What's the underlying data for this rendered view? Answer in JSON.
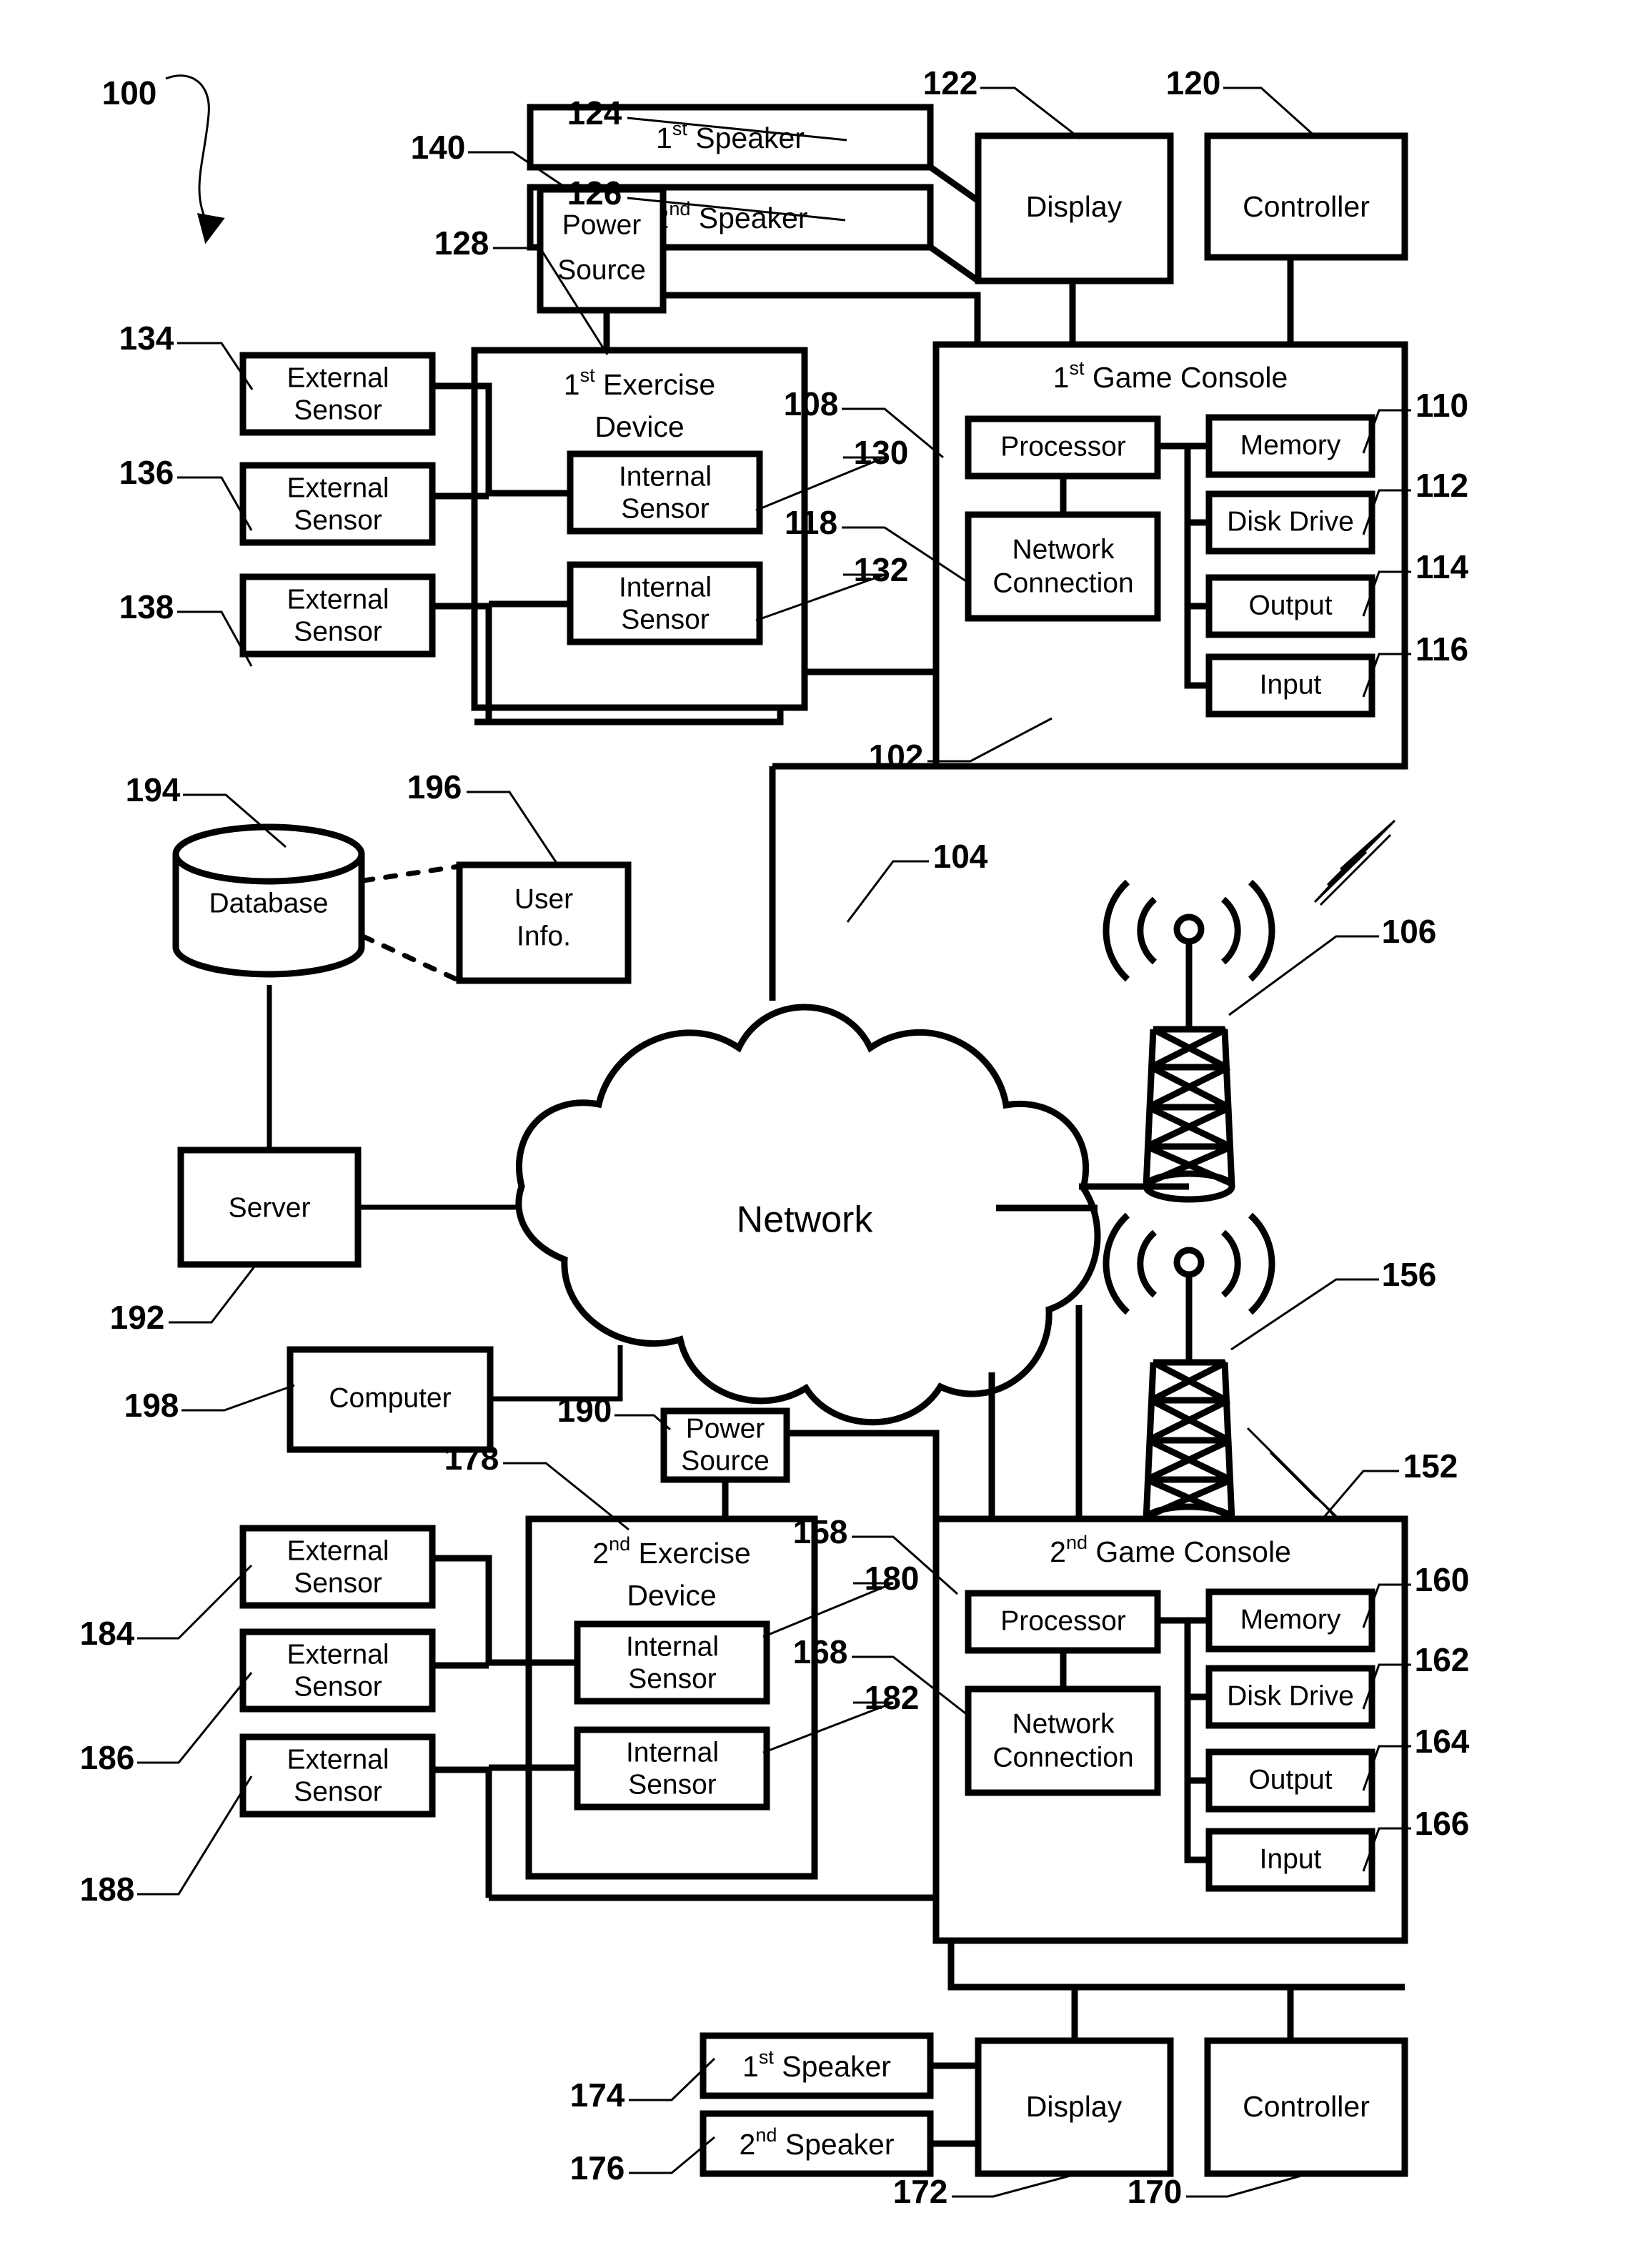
{
  "figure": {
    "number": "100",
    "type": "patent-block-diagram"
  },
  "boxes": {
    "speaker1_top": "Speaker",
    "speaker1_top_ord": "1",
    "speaker1_top_sup": "st",
    "speaker2_top": "Speaker",
    "speaker2_top_ord": "2",
    "speaker2_top_sup": "nd",
    "display_top": "Display",
    "controller_top": "Controller",
    "power_source_top_l1": "Power",
    "power_source_top_l2": "Source",
    "exercise1_l1_ord": "1",
    "exercise1_l1_sup": "st",
    "exercise1_l1": "Exercise",
    "exercise1_l2": "Device",
    "console1_ord": "1",
    "console1_sup": "st",
    "console1": "Game Console",
    "processor": "Processor",
    "network_connection_l1": "Network",
    "network_connection_l2": "Connection",
    "memory": "Memory",
    "disk_drive": "Disk Drive",
    "output": "Output",
    "input": "Input",
    "internal_sensor_l1": "Internal",
    "internal_sensor_l2": "Sensor",
    "external_sensor_l1": "External",
    "external_sensor_l2": "Sensor",
    "database": "Database",
    "user_info_l1": "User",
    "user_info_l2": "Info.",
    "server": "Server",
    "computer": "Computer",
    "network": "Network",
    "power_source_bot_l1": "Power",
    "power_source_bot_l2": "Source",
    "exercise2_l1_ord": "2",
    "exercise2_l1_sup": "nd",
    "exercise2_l1": "Exercise",
    "exercise2_l2": "Device",
    "console2_ord": "2",
    "console2_sup": "nd",
    "console2": "Game Console",
    "speaker1_bot": "Speaker",
    "speaker1_bot_ord": "1",
    "speaker1_bot_sup": "st",
    "speaker2_bot": "Speaker",
    "speaker2_bot_ord": "2",
    "speaker2_bot_sup": "nd",
    "display_bot": "Display",
    "controller_bot": "Controller"
  },
  "refs": {
    "r100": "100",
    "r102": "102",
    "r104": "104",
    "r106": "106",
    "r108": "108",
    "r110": "110",
    "r112": "112",
    "r114": "114",
    "r116": "116",
    "r118": "118",
    "r120": "120",
    "r122": "122",
    "r124": "124",
    "r126": "126",
    "r128": "128",
    "r130": "130",
    "r132": "132",
    "r134": "134",
    "r136": "136",
    "r138": "138",
    "r140": "140",
    "r152": "152",
    "r156": "156",
    "r158": "158",
    "r160": "160",
    "r162": "162",
    "r164": "164",
    "r166": "166",
    "r168": "168",
    "r170": "170",
    "r172": "172",
    "r174": "174",
    "r176": "176",
    "r178": "178",
    "r180": "180",
    "r182": "182",
    "r184": "184",
    "r186": "186",
    "r188": "188",
    "r190": "190",
    "r192": "192",
    "r194": "194",
    "r196": "196",
    "r198": "198"
  },
  "colors": {
    "line": "#000000",
    "background": "#ffffff"
  }
}
